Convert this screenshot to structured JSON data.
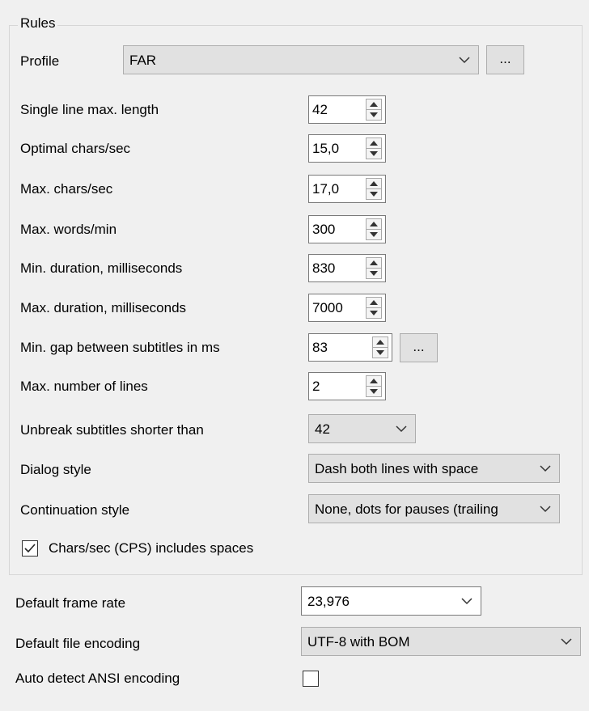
{
  "rules": {
    "title": "Rules",
    "profile": {
      "label": "Profile",
      "value": "FAR",
      "more_label": "..."
    },
    "fields": [
      {
        "label": "Single line max. length",
        "value": "42"
      },
      {
        "label": "Optimal chars/sec",
        "value": "15,0"
      },
      {
        "label": "Max. chars/sec",
        "value": "17,0"
      },
      {
        "label": "Max. words/min",
        "value": "300"
      },
      {
        "label": "Min. duration, milliseconds",
        "value": "830"
      },
      {
        "label": "Max. duration, milliseconds",
        "value": "7000"
      },
      {
        "label": "Min. gap between subtitles in ms",
        "value": "83",
        "more_label": "..."
      },
      {
        "label": "Max. number of lines",
        "value": "2"
      }
    ],
    "unbreak": {
      "label": "Unbreak subtitles shorter than",
      "value": "42"
    },
    "dialog_style": {
      "label": "Dialog style",
      "value": "Dash both lines with space"
    },
    "continuation_style": {
      "label": "Continuation style",
      "value": "None, dots for pauses (trailing"
    },
    "cps_includes_spaces": {
      "label": "Chars/sec (CPS) includes spaces",
      "checked": true
    }
  },
  "default_frame_rate": {
    "label": "Default frame rate",
    "value": "23,976"
  },
  "default_file_encoding": {
    "label": "Default file encoding",
    "value": "UTF-8 with BOM"
  },
  "auto_detect_ansi": {
    "label": "Auto detect ANSI encoding",
    "checked": false
  }
}
